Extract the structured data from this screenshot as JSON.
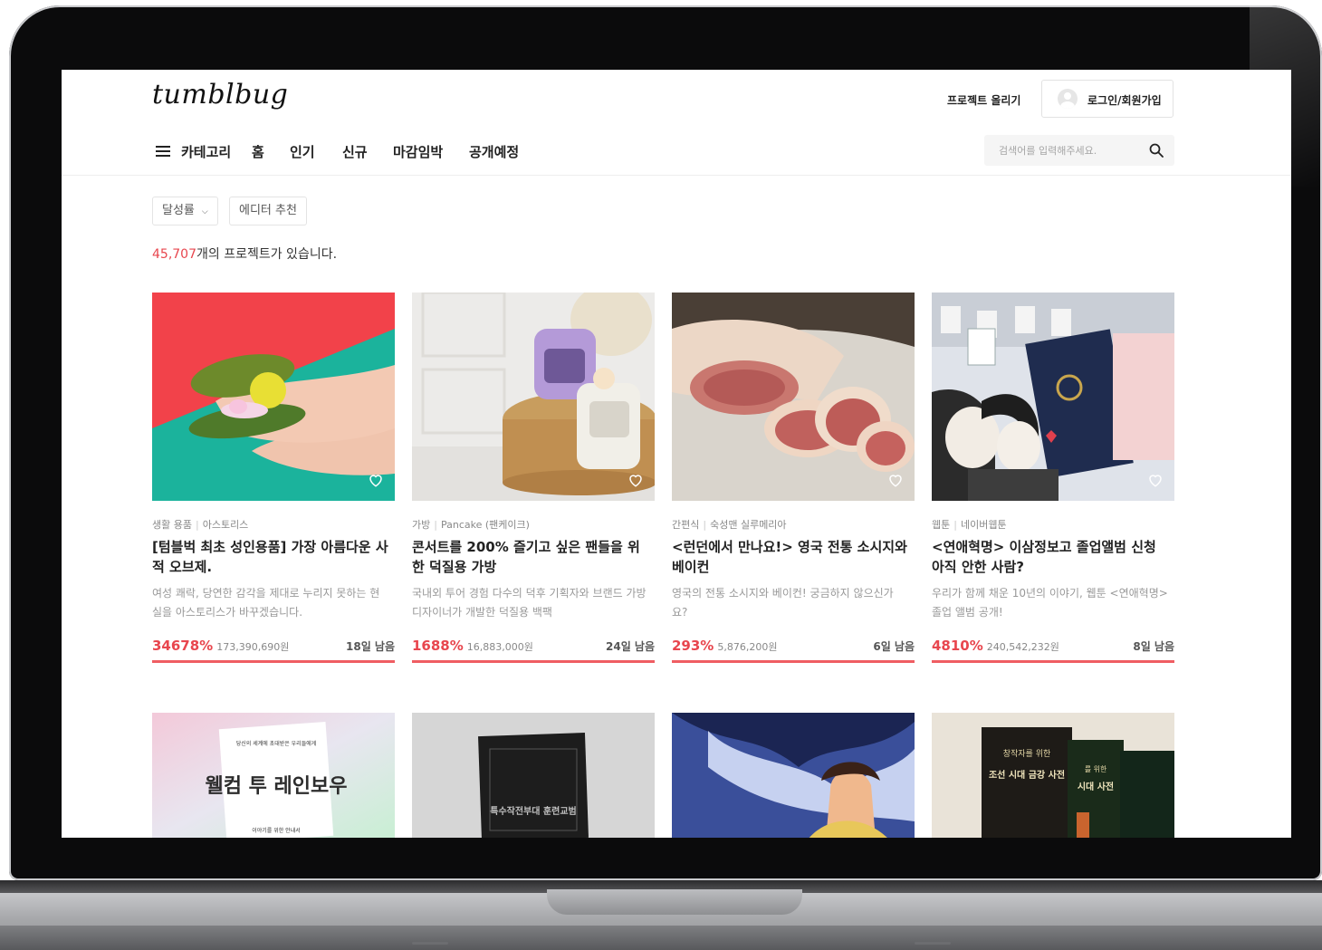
{
  "header": {
    "logo": "tumblbug",
    "upload_link": "프로젝트 올리기",
    "login_label": "로그인/회원가입"
  },
  "nav": {
    "category_label": "카테고리",
    "items": [
      "홈",
      "인기",
      "신규",
      "마감임박",
      "공개예정"
    ]
  },
  "search": {
    "placeholder": "검색어를 입력해주세요."
  },
  "filters": {
    "sort_label": "달성률",
    "editor_label": "에디터 추천"
  },
  "summary": {
    "count": "45,707",
    "suffix": "개의 프로젝트가 있습니다."
  },
  "colors": {
    "accent": "#e8464e",
    "progress": "#ef5d62"
  },
  "projects": [
    {
      "category": "생활 용품",
      "creator": "아스토리스",
      "title": "[텀블벅 최초 성인용품] 가장 아름다운 사적 오브제.",
      "description": "여성 쾌락, 당연한 감각을 제대로 누리지 못하는 현실을 아스토리스가 바꾸겠습니다.",
      "percent": "34678%",
      "amount": "173,390,690원",
      "days_left": "18일 남음",
      "progress": 1.0,
      "image": "avocado-shaped-object-in-hands"
    },
    {
      "category": "가방",
      "creator": "Pancake (팬케이크)",
      "title": "콘서트를 200% 즐기고 싶은 팬들을 위한 덕질용 가방",
      "description": "국내외 투어 경험 다수의 덕후 기획자와 브랜드 가방 디자이너가 개발한 덕질용 백팩",
      "percent": "1688%",
      "amount": "16,883,000원",
      "days_left": "24일 남음",
      "progress": 1.0,
      "image": "backpacks-on-rattan-stool"
    },
    {
      "category": "간편식",
      "creator": "숙성맨 실루메리아",
      "title": "<런던에서 만나요!> 영국 전통 소시지와 베이컨",
      "description": "영국의 전통 소시지와 베이컨! 궁금하지 않으신가요?",
      "percent": "293%",
      "amount": "5,876,200원",
      "days_left": "6일 남음",
      "progress": 1.0,
      "image": "sliced-bacon-on-paper"
    },
    {
      "category": "웹툰",
      "creator": "네이버웹툰",
      "title": "<연애혁명> 이삼정보고 졸업앨범 신청 아직 안한 사람?",
      "description": "우리가 함께 채운 10년의 이야기, 웹툰 <연애혁명> 졸업 앨범 공개!",
      "percent": "4810%",
      "amount": "240,542,232원",
      "days_left": "8일 남음",
      "progress": 1.0,
      "image": "webtoon-graduation-album"
    }
  ],
  "second_row": [
    {
      "image": "book-welcome-to-rainbow",
      "book_small": "당신의 세계에 초대받은 우리들에게",
      "book_title": "웰컴 투 레인보우",
      "book_sub": "이야기를 위한 안내서"
    },
    {
      "image": "black-book-mockup",
      "book_title": "특수작전부대 훈련교범"
    },
    {
      "image": "fantasy-webtoon-character"
    },
    {
      "image": "joseon-era-books",
      "book_small": "창작자를 위한",
      "book_title": "조선 시대 금강 사전",
      "book_title_b": "시대 사전",
      "book_small_b": "를 위한"
    }
  ]
}
